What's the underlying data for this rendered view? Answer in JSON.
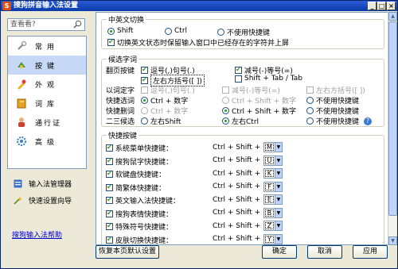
{
  "window": {
    "title": "搜狗拼音输入法设置",
    "min": "_",
    "max": "□",
    "close": "×"
  },
  "search": {
    "placeholder": "查看看?"
  },
  "nav": [
    {
      "label": "常用",
      "icon": "wrench-icon"
    },
    {
      "label": "按键",
      "icon": "keyboard-icon"
    },
    {
      "label": "外观",
      "icon": "palette-icon"
    },
    {
      "label": "词库",
      "icon": "book-icon"
    },
    {
      "label": "通行证",
      "icon": "user-icon"
    },
    {
      "label": "高级",
      "icon": "gear-icon"
    }
  ],
  "side_buttons": {
    "manager": "输入法管理器",
    "wizard": "快速设置向导"
  },
  "help_link": "搜狗输入法帮助",
  "switch_group": {
    "legend": "中英文切换",
    "shift": "Shift",
    "ctrl": "Ctrl",
    "none": "不使用快捷键",
    "commit_option": "切换英文状态时保留输入窗口中已经存在的字符并上屏"
  },
  "candidate_group": {
    "legend": "候选字词",
    "page_label": "翻页按键",
    "page_opt1": "逗号(,)句号(.)",
    "page_opt2": "减号(-)等号(=)",
    "page_opt3": "左右方括号([ ])",
    "page_opt4": "Shift + Tab / Tab",
    "word_label": "以词定字",
    "word_opt1": "逗号(,)句号(.)",
    "word_opt2": "减号(-)等号(=)",
    "word_opt3": "左右方括号([ ])",
    "quick_select_label": "快捷选词",
    "quick_del_label": "快捷删词",
    "quick_opt1": "Ctrl + 数字",
    "quick_opt2": "Ctrl + Shift + 数字",
    "quick_opt3": "不使用快捷键",
    "del_opt1": "Ctrl + 数字",
    "del_opt2": "Ctrl + Shift + 数字",
    "del_opt3": "不使用快捷键",
    "second_third_label": "二三候选",
    "st_opt1": "左右Shift",
    "st_opt2": "左右Ctrl",
    "st_opt3": "不使用快捷键",
    "help_q": "?"
  },
  "hotkey_group": {
    "legend": "快捷按键",
    "prefix": "Ctrl + Shift +",
    "items": [
      {
        "label": "系统菜单快捷键：",
        "key": "M"
      },
      {
        "label": "搜狗鼠字快捷键：",
        "key": "U"
      },
      {
        "label": "软键盘快捷键：",
        "key": "K"
      },
      {
        "label": "简繁体快捷键：",
        "key": "F"
      },
      {
        "label": "英文输入法快捷键：",
        "key": "E"
      },
      {
        "label": "搜狗表情快捷键：",
        "key": "B"
      },
      {
        "label": "特殊符号快捷键：",
        "key": "Z"
      },
      {
        "label": "皮肤切换快捷键：",
        "key": "Y"
      }
    ]
  },
  "buttons": {
    "restore": "恢复本页默认设置",
    "ok": "确定",
    "cancel": "取消",
    "apply": "应用"
  },
  "colors": {
    "titlebar": "#2a5bd7",
    "selection": "#c6d8f5",
    "check": "#21a121",
    "link": "#0000cc"
  }
}
